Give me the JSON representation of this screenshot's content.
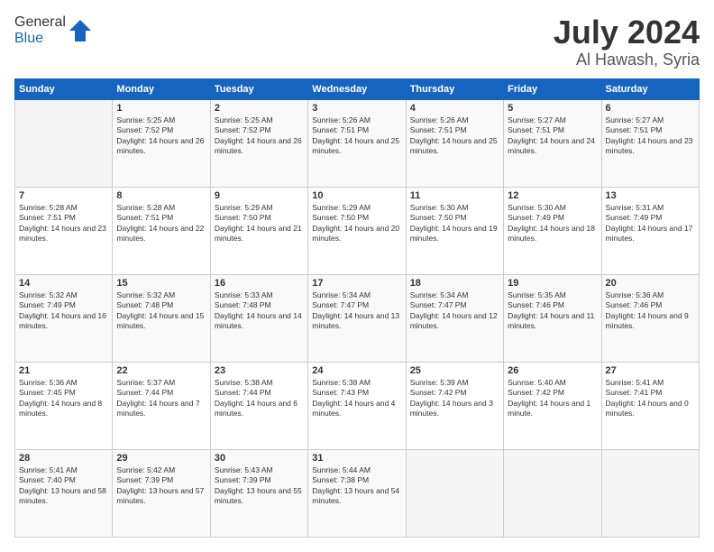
{
  "logo": {
    "general": "General",
    "blue": "Blue"
  },
  "header": {
    "title": "July 2024",
    "subtitle": "Al Hawash, Syria"
  },
  "calendar": {
    "columns": [
      "Sunday",
      "Monday",
      "Tuesday",
      "Wednesday",
      "Thursday",
      "Friday",
      "Saturday"
    ],
    "rows": [
      [
        {
          "day": "",
          "sunrise": "",
          "sunset": "",
          "daylight": ""
        },
        {
          "day": "1",
          "sunrise": "Sunrise: 5:25 AM",
          "sunset": "Sunset: 7:52 PM",
          "daylight": "Daylight: 14 hours and 26 minutes."
        },
        {
          "day": "2",
          "sunrise": "Sunrise: 5:25 AM",
          "sunset": "Sunset: 7:52 PM",
          "daylight": "Daylight: 14 hours and 26 minutes."
        },
        {
          "day": "3",
          "sunrise": "Sunrise: 5:26 AM",
          "sunset": "Sunset: 7:51 PM",
          "daylight": "Daylight: 14 hours and 25 minutes."
        },
        {
          "day": "4",
          "sunrise": "Sunrise: 5:26 AM",
          "sunset": "Sunset: 7:51 PM",
          "daylight": "Daylight: 14 hours and 25 minutes."
        },
        {
          "day": "5",
          "sunrise": "Sunrise: 5:27 AM",
          "sunset": "Sunset: 7:51 PM",
          "daylight": "Daylight: 14 hours and 24 minutes."
        },
        {
          "day": "6",
          "sunrise": "Sunrise: 5:27 AM",
          "sunset": "Sunset: 7:51 PM",
          "daylight": "Daylight: 14 hours and 23 minutes."
        }
      ],
      [
        {
          "day": "7",
          "sunrise": "Sunrise: 5:28 AM",
          "sunset": "Sunset: 7:51 PM",
          "daylight": "Daylight: 14 hours and 23 minutes."
        },
        {
          "day": "8",
          "sunrise": "Sunrise: 5:28 AM",
          "sunset": "Sunset: 7:51 PM",
          "daylight": "Daylight: 14 hours and 22 minutes."
        },
        {
          "day": "9",
          "sunrise": "Sunrise: 5:29 AM",
          "sunset": "Sunset: 7:50 PM",
          "daylight": "Daylight: 14 hours and 21 minutes."
        },
        {
          "day": "10",
          "sunrise": "Sunrise: 5:29 AM",
          "sunset": "Sunset: 7:50 PM",
          "daylight": "Daylight: 14 hours and 20 minutes."
        },
        {
          "day": "11",
          "sunrise": "Sunrise: 5:30 AM",
          "sunset": "Sunset: 7:50 PM",
          "daylight": "Daylight: 14 hours and 19 minutes."
        },
        {
          "day": "12",
          "sunrise": "Sunrise: 5:30 AM",
          "sunset": "Sunset: 7:49 PM",
          "daylight": "Daylight: 14 hours and 18 minutes."
        },
        {
          "day": "13",
          "sunrise": "Sunrise: 5:31 AM",
          "sunset": "Sunset: 7:49 PM",
          "daylight": "Daylight: 14 hours and 17 minutes."
        }
      ],
      [
        {
          "day": "14",
          "sunrise": "Sunrise: 5:32 AM",
          "sunset": "Sunset: 7:49 PM",
          "daylight": "Daylight: 14 hours and 16 minutes."
        },
        {
          "day": "15",
          "sunrise": "Sunrise: 5:32 AM",
          "sunset": "Sunset: 7:48 PM",
          "daylight": "Daylight: 14 hours and 15 minutes."
        },
        {
          "day": "16",
          "sunrise": "Sunrise: 5:33 AM",
          "sunset": "Sunset: 7:48 PM",
          "daylight": "Daylight: 14 hours and 14 minutes."
        },
        {
          "day": "17",
          "sunrise": "Sunrise: 5:34 AM",
          "sunset": "Sunset: 7:47 PM",
          "daylight": "Daylight: 14 hours and 13 minutes."
        },
        {
          "day": "18",
          "sunrise": "Sunrise: 5:34 AM",
          "sunset": "Sunset: 7:47 PM",
          "daylight": "Daylight: 14 hours and 12 minutes."
        },
        {
          "day": "19",
          "sunrise": "Sunrise: 5:35 AM",
          "sunset": "Sunset: 7:46 PM",
          "daylight": "Daylight: 14 hours and 11 minutes."
        },
        {
          "day": "20",
          "sunrise": "Sunrise: 5:36 AM",
          "sunset": "Sunset: 7:46 PM",
          "daylight": "Daylight: 14 hours and 9 minutes."
        }
      ],
      [
        {
          "day": "21",
          "sunrise": "Sunrise: 5:36 AM",
          "sunset": "Sunset: 7:45 PM",
          "daylight": "Daylight: 14 hours and 8 minutes."
        },
        {
          "day": "22",
          "sunrise": "Sunrise: 5:37 AM",
          "sunset": "Sunset: 7:44 PM",
          "daylight": "Daylight: 14 hours and 7 minutes."
        },
        {
          "day": "23",
          "sunrise": "Sunrise: 5:38 AM",
          "sunset": "Sunset: 7:44 PM",
          "daylight": "Daylight: 14 hours and 6 minutes."
        },
        {
          "day": "24",
          "sunrise": "Sunrise: 5:38 AM",
          "sunset": "Sunset: 7:43 PM",
          "daylight": "Daylight: 14 hours and 4 minutes."
        },
        {
          "day": "25",
          "sunrise": "Sunrise: 5:39 AM",
          "sunset": "Sunset: 7:42 PM",
          "daylight": "Daylight: 14 hours and 3 minutes."
        },
        {
          "day": "26",
          "sunrise": "Sunrise: 5:40 AM",
          "sunset": "Sunset: 7:42 PM",
          "daylight": "Daylight: 14 hours and 1 minute."
        },
        {
          "day": "27",
          "sunrise": "Sunrise: 5:41 AM",
          "sunset": "Sunset: 7:41 PM",
          "daylight": "Daylight: 14 hours and 0 minutes."
        }
      ],
      [
        {
          "day": "28",
          "sunrise": "Sunrise: 5:41 AM",
          "sunset": "Sunset: 7:40 PM",
          "daylight": "Daylight: 13 hours and 58 minutes."
        },
        {
          "day": "29",
          "sunrise": "Sunrise: 5:42 AM",
          "sunset": "Sunset: 7:39 PM",
          "daylight": "Daylight: 13 hours and 57 minutes."
        },
        {
          "day": "30",
          "sunrise": "Sunrise: 5:43 AM",
          "sunset": "Sunset: 7:39 PM",
          "daylight": "Daylight: 13 hours and 55 minutes."
        },
        {
          "day": "31",
          "sunrise": "Sunrise: 5:44 AM",
          "sunset": "Sunset: 7:38 PM",
          "daylight": "Daylight: 13 hours and 54 minutes."
        },
        {
          "day": "",
          "sunrise": "",
          "sunset": "",
          "daylight": ""
        },
        {
          "day": "",
          "sunrise": "",
          "sunset": "",
          "daylight": ""
        },
        {
          "day": "",
          "sunrise": "",
          "sunset": "",
          "daylight": ""
        }
      ]
    ]
  }
}
